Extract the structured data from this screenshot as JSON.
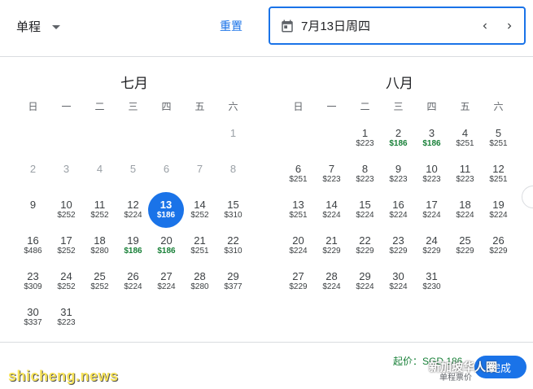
{
  "header": {
    "trip_type": "单程",
    "reset_label": "重置",
    "date_value": "7月13日周四"
  },
  "weekdays": [
    "日",
    "一",
    "二",
    "三",
    "四",
    "五",
    "六"
  ],
  "months": [
    {
      "title": "七月",
      "offset": 6,
      "days": [
        {
          "d": "1",
          "past": true
        },
        {
          "d": "2",
          "past": true
        },
        {
          "d": "3",
          "past": true
        },
        {
          "d": "4",
          "past": true
        },
        {
          "d": "5",
          "past": true
        },
        {
          "d": "6",
          "past": true
        },
        {
          "d": "7",
          "past": true
        },
        {
          "d": "8",
          "past": true
        },
        {
          "d": "9"
        },
        {
          "d": "10",
          "p": "$252"
        },
        {
          "d": "11",
          "p": "$252"
        },
        {
          "d": "12",
          "p": "$224"
        },
        {
          "d": "13",
          "p": "$186",
          "sel": true
        },
        {
          "d": "14",
          "p": "$252"
        },
        {
          "d": "15",
          "p": "$310"
        },
        {
          "d": "16",
          "p": "$486"
        },
        {
          "d": "17",
          "p": "$252"
        },
        {
          "d": "18",
          "p": "$280"
        },
        {
          "d": "19",
          "p": "$186",
          "low": true
        },
        {
          "d": "20",
          "p": "$186",
          "low": true
        },
        {
          "d": "21",
          "p": "$251"
        },
        {
          "d": "22",
          "p": "$310"
        },
        {
          "d": "23",
          "p": "$309"
        },
        {
          "d": "24",
          "p": "$252"
        },
        {
          "d": "25",
          "p": "$252"
        },
        {
          "d": "26",
          "p": "$224"
        },
        {
          "d": "27",
          "p": "$224"
        },
        {
          "d": "28",
          "p": "$280"
        },
        {
          "d": "29",
          "p": "$377"
        },
        {
          "d": "30",
          "p": "$337"
        },
        {
          "d": "31",
          "p": "$223"
        }
      ]
    },
    {
      "title": "八月",
      "offset": 2,
      "days": [
        {
          "d": "1",
          "p": "$223"
        },
        {
          "d": "2",
          "p": "$186",
          "low": true
        },
        {
          "d": "3",
          "p": "$186",
          "low": true
        },
        {
          "d": "4",
          "p": "$251"
        },
        {
          "d": "5",
          "p": "$251"
        },
        {
          "d": "6",
          "p": "$251"
        },
        {
          "d": "7",
          "p": "$223"
        },
        {
          "d": "8",
          "p": "$223"
        },
        {
          "d": "9",
          "p": "$223"
        },
        {
          "d": "10",
          "p": "$223"
        },
        {
          "d": "11",
          "p": "$223"
        },
        {
          "d": "12",
          "p": "$251"
        },
        {
          "d": "13",
          "p": "$251"
        },
        {
          "d": "14",
          "p": "$224"
        },
        {
          "d": "15",
          "p": "$224"
        },
        {
          "d": "16",
          "p": "$224"
        },
        {
          "d": "17",
          "p": "$224"
        },
        {
          "d": "18",
          "p": "$224"
        },
        {
          "d": "19",
          "p": "$224"
        },
        {
          "d": "20",
          "p": "$224"
        },
        {
          "d": "21",
          "p": "$229"
        },
        {
          "d": "22",
          "p": "$229"
        },
        {
          "d": "23",
          "p": "$229"
        },
        {
          "d": "24",
          "p": "$229"
        },
        {
          "d": "25",
          "p": "$229"
        },
        {
          "d": "26",
          "p": "$229"
        },
        {
          "d": "27",
          "p": "$229"
        },
        {
          "d": "28",
          "p": "$224"
        },
        {
          "d": "29",
          "p": "$224"
        },
        {
          "d": "30",
          "p": "$224"
        },
        {
          "d": "31",
          "p": "$230"
        }
      ]
    }
  ],
  "footer": {
    "lowest_label": "起价：SGD 186",
    "lowest_sub": "单程票价",
    "done_label": "完成"
  },
  "watermarks": {
    "left": "shicheng.news",
    "right": "新加坡华人圈"
  },
  "colors": {
    "accent": "#1a73e8",
    "low_price": "#188038"
  }
}
